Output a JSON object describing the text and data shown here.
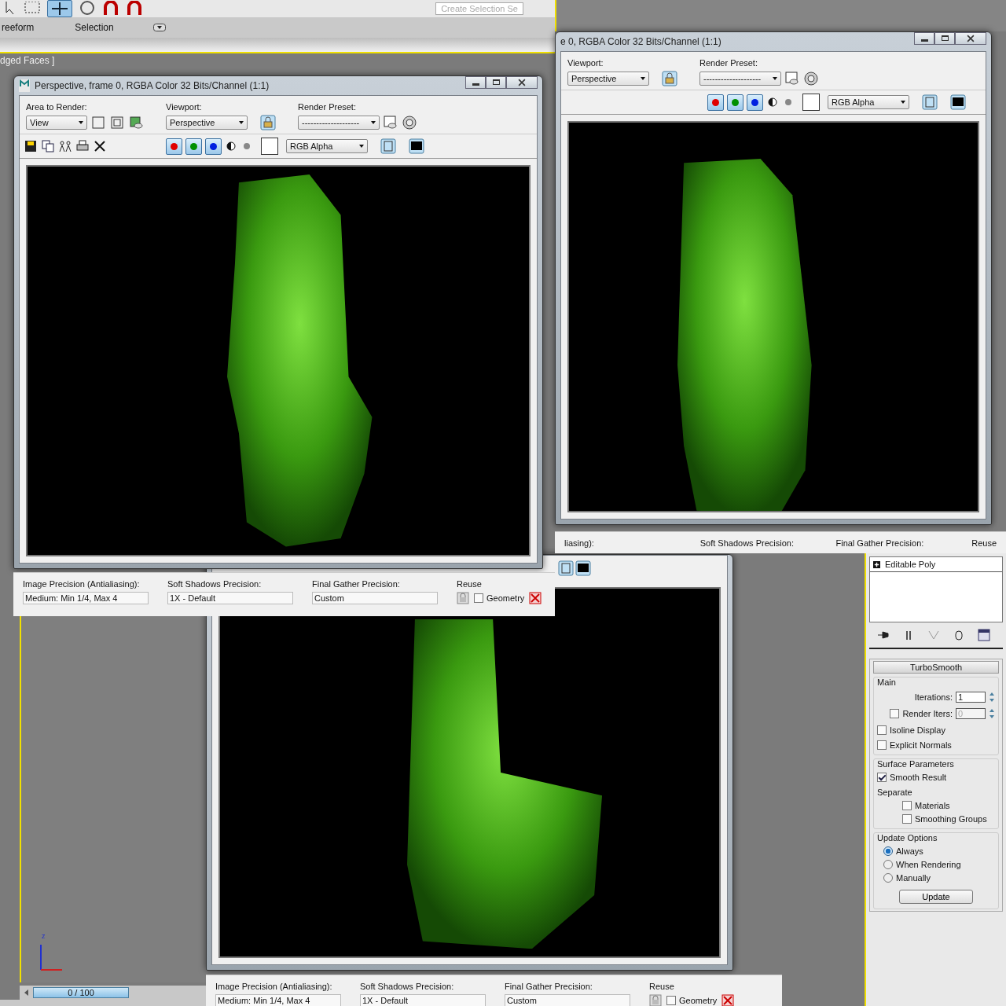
{
  "toolbar": {
    "selection_placeholder": "Create Selection Se",
    "ribbon_tabs": [
      "reeform",
      "Selection"
    ],
    "viewport_label": "dged Faces ]"
  },
  "render_windows": [
    {
      "title": "Perspective, frame 0, RGBA Color 32 Bits/Channel (1:1)",
      "header": {
        "area": {
          "label": "Area to Render:",
          "value": "View"
        },
        "viewport": {
          "label": "Viewport:",
          "value": "Perspective"
        },
        "preset": {
          "label": "Render Preset:",
          "value": "--------------------"
        },
        "channel_value": "RGB Alpha",
        "channels": [
          {
            "color": "#e00000",
            "on": true
          },
          {
            "color": "#009000",
            "on": true
          },
          {
            "color": "#0020e0",
            "on": true
          }
        ]
      }
    },
    {
      "title": "e 0, RGBA Color 32 Bits/Channel (1:1)",
      "header": {
        "viewport": {
          "label": "Viewport:",
          "value": "Perspective"
        },
        "preset": {
          "label": "Render Preset:",
          "value": "--------------------"
        },
        "channel_value": "RGB Alpha",
        "channels": [
          {
            "color": "#e00000",
            "on": true
          },
          {
            "color": "#009000",
            "on": true
          },
          {
            "color": "#0020e0",
            "on": true
          }
        ]
      }
    }
  ],
  "settings_strips": [
    {
      "fields": [
        {
          "label": "Image Precision (Antialiasing):",
          "value": "Medium: Min 1/4, Max 4"
        },
        {
          "label": "Soft Shadows Precision:",
          "value": "1X - Default"
        },
        {
          "label": "Final Gather Precision:",
          "value": "Custom"
        }
      ],
      "reuse": {
        "label": "Reuse",
        "geometry": {
          "label": "Geometry",
          "checked": false
        }
      }
    },
    {
      "fields": [
        {
          "label": "liasing):"
        },
        {
          "label": "Soft Shadows Precision:"
        },
        {
          "label": "Final Gather Precision:"
        }
      ],
      "reuse": {
        "label": "Reuse"
      }
    },
    {
      "fields": [
        {
          "label": "Image Precision (Antialiasing):",
          "value": "Medium: Min 1/4, Max 4"
        },
        {
          "label": "Soft Shadows Precision:",
          "value": "1X - Default"
        },
        {
          "label": "Final Gather Precision:",
          "value": "Custom"
        }
      ],
      "reuse": {
        "label": "Reuse",
        "geometry": {
          "label": "Geometry",
          "checked": false
        }
      }
    }
  ],
  "command_panel": {
    "modifier_stack": [
      {
        "label": "Editable Poly",
        "expanded": false
      }
    ],
    "rollout": {
      "title": "TurboSmooth",
      "main": {
        "title": "Main",
        "iterations": {
          "label": "Iterations:",
          "value": "1"
        },
        "render_iters": {
          "label": "Render Iters:",
          "value": "0",
          "disabled": true,
          "checked": false
        },
        "options": [
          {
            "label": "Isoline Display",
            "checked": false
          },
          {
            "label": "Explicit Normals",
            "checked": false
          }
        ]
      },
      "surface": {
        "title": "Surface Parameters",
        "smooth_result": {
          "label": "Smooth Result",
          "checked": true
        },
        "separate_label": "Separate",
        "separate": [
          {
            "label": "Materials",
            "checked": false
          },
          {
            "label": "Smoothing Groups",
            "checked": false
          }
        ]
      },
      "update": {
        "title": "Update Options",
        "options": [
          {
            "label": "Always",
            "selected": true
          },
          {
            "label": "When Rendering",
            "selected": false
          },
          {
            "label": "Manually",
            "selected": false
          }
        ],
        "button": "Update"
      }
    }
  },
  "axis_label": "z",
  "time_slider": {
    "label": "0 / 100"
  }
}
